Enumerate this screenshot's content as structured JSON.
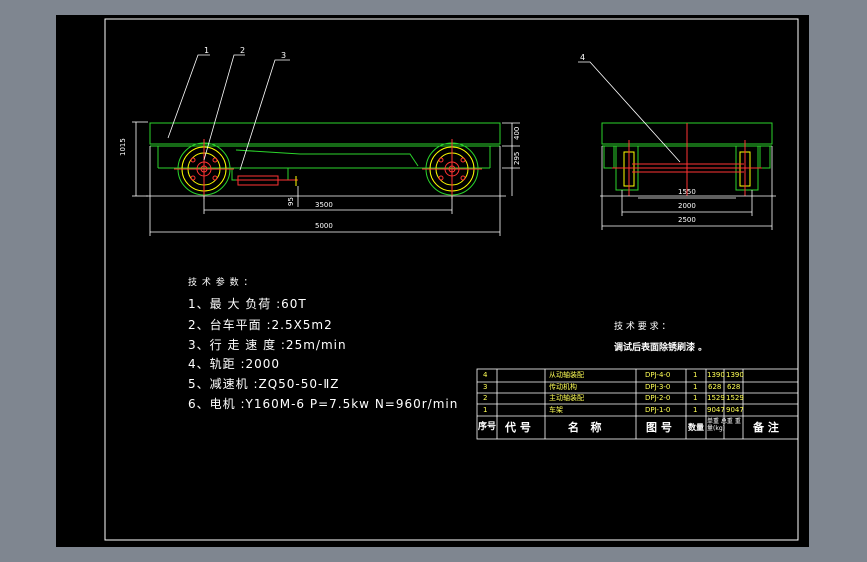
{
  "parts": {
    "p1": "1",
    "p2": "2",
    "p3": "3",
    "p4": "4"
  },
  "dims": {
    "height_total": "1015",
    "h400": "400",
    "h295": "295",
    "d95": "95",
    "wheelbase": "3500",
    "length": "5000",
    "d1550": "1550",
    "gauge": "2000",
    "width": "2500"
  },
  "tech_left": {
    "title": "技 术 参 数 ：",
    "items": [
      "1、最 大 负荷 :60T",
      "2、台车平面 :2.5X5m2",
      "3、行 走 速 度 :25m/min",
      "4、轨距 :2000",
      "5、减速机 :ZQ50-50-ⅡZ",
      "6、电机 :Y160M-6  P=7.5kw  N=960r/min"
    ]
  },
  "tech_right": {
    "title": "技 术 要 求 ：",
    "line": "调试后表面除锈刷漆 。"
  },
  "bom": {
    "rows": [
      {
        "no": "4",
        "name": "从动轴装配",
        "code": "DPJ-4-0",
        "qty": "1",
        "w1": "1390",
        "w2": "1390"
      },
      {
        "no": "3",
        "name": "传动机构",
        "code": "DPJ-3-0",
        "qty": "1",
        "w1": "628",
        "w2": "628"
      },
      {
        "no": "2",
        "name": "主动轴装配",
        "code": "DPJ-2-0",
        "qty": "1",
        "w1": "1529",
        "w2": "1529"
      },
      {
        "no": "1",
        "name": "车架",
        "code": "DPJ-1-0",
        "qty": "1",
        "w1": "9047",
        "w2": "9047"
      }
    ],
    "header": {
      "no": "序号",
      "code": "代 号",
      "name": "名   称",
      "drawing": "图 号",
      "qty": "数量",
      "weight": "单重 总重 重量(kg)",
      "note": "备 注"
    }
  }
}
